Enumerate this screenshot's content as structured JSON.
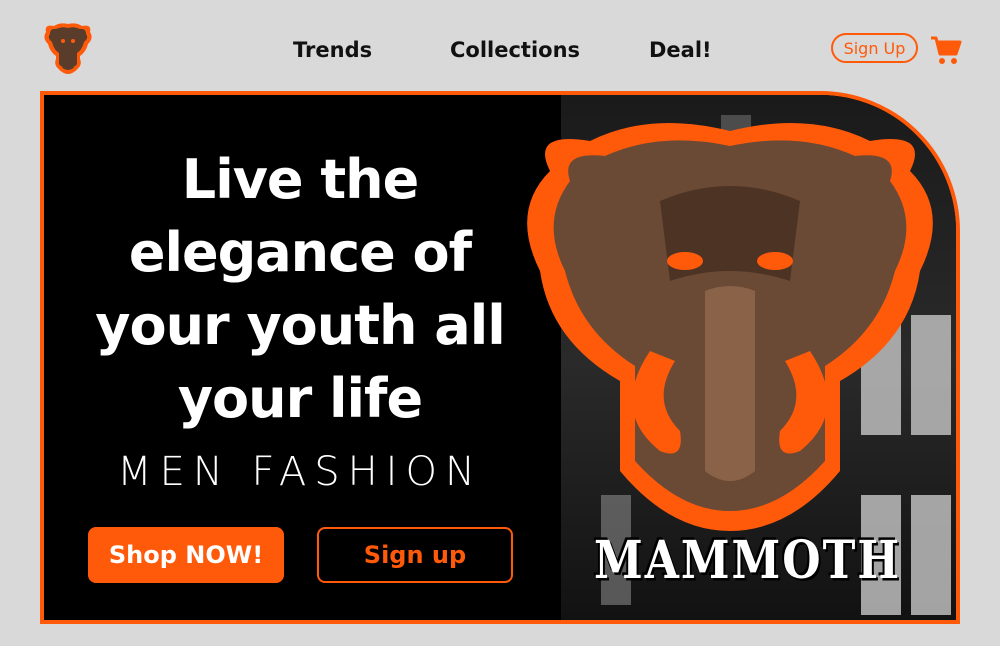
{
  "brand": {
    "logo_icon": "mammoth-logo-icon",
    "name": "MAMMOTH"
  },
  "nav": {
    "items": [
      "Trends",
      "Collections",
      "Deal!"
    ],
    "signup_label": "Sign Up",
    "cart_icon": "shopping-cart-icon"
  },
  "hero": {
    "headline": [
      "Live the",
      "elegance of",
      "your youth all",
      "your life"
    ],
    "subtitle": "MEN FASHION",
    "shop_button": "Shop NOW!",
    "signup_button": "Sign up"
  },
  "colors": {
    "accent": "#ff5a0a",
    "background": "#d9d9d9",
    "hero_bg": "#000000"
  }
}
